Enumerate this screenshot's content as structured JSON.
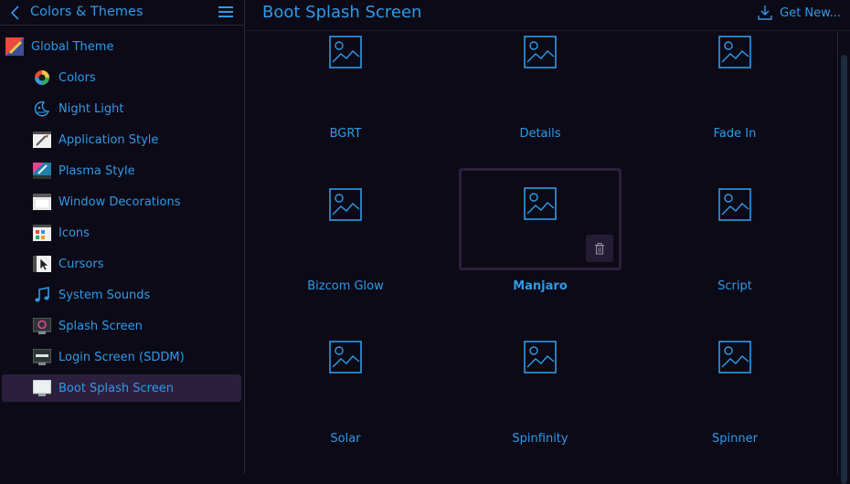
{
  "sidebar": {
    "title": "Colors & Themes",
    "global_theme": {
      "label": "Global Theme",
      "icon": "global-theme-icon"
    },
    "items": [
      {
        "label": "Colors",
        "icon": "colors-icon"
      },
      {
        "label": "Night Light",
        "icon": "night-light-icon"
      },
      {
        "label": "Application Style",
        "icon": "application-style-icon"
      },
      {
        "label": "Plasma Style",
        "icon": "plasma-style-icon"
      },
      {
        "label": "Window Decorations",
        "icon": "window-decorations-icon"
      },
      {
        "label": "Icons",
        "icon": "icons-icon"
      },
      {
        "label": "Cursors",
        "icon": "cursors-icon"
      },
      {
        "label": "System Sounds",
        "icon": "system-sounds-icon"
      },
      {
        "label": "Splash Screen",
        "icon": "splash-screen-icon"
      },
      {
        "label": "Login Screen (SDDM)",
        "icon": "login-screen-icon"
      },
      {
        "label": "Boot Splash Screen",
        "icon": "boot-splash-screen-icon"
      }
    ]
  },
  "main": {
    "title": "Boot Splash Screen",
    "get_new_label": "Get New...",
    "themes": [
      {
        "label": "BGRT"
      },
      {
        "label": "Details"
      },
      {
        "label": "Fade In"
      },
      {
        "label": "Bizcom Glow"
      },
      {
        "label": "Manjaro"
      },
      {
        "label": "Script"
      },
      {
        "label": "Solar"
      },
      {
        "label": "Spinfinity"
      },
      {
        "label": "Spinner"
      }
    ],
    "selected_theme": "Manjaro"
  },
  "colors": {
    "accent": "#2f9ae8",
    "background": "#0c0a16",
    "selection": "#2c1f3d"
  }
}
